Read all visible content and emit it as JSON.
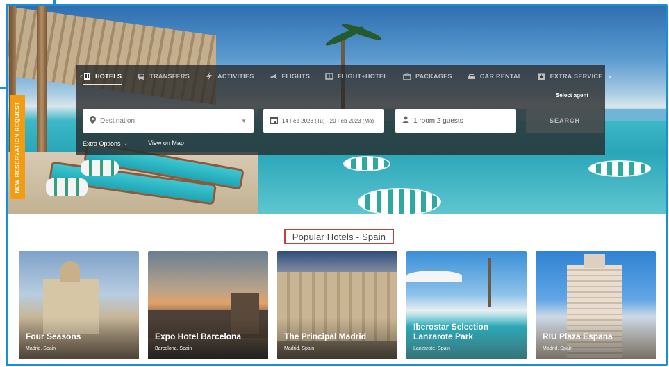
{
  "search_panel": {
    "tabs": [
      {
        "label": "HOTELS",
        "active": true,
        "icon": "building-icon"
      },
      {
        "label": "TRANSFERS",
        "active": false,
        "icon": "bus-icon"
      },
      {
        "label": "ACTIVITIES",
        "active": false,
        "icon": "bolt-icon"
      },
      {
        "label": "FLIGHTS",
        "active": false,
        "icon": "plane-icon"
      },
      {
        "label": "FLIGHT+HOTEL",
        "active": false,
        "icon": "ticket-icon"
      },
      {
        "label": "PACKAGES",
        "active": false,
        "icon": "suitcase-icon"
      },
      {
        "label": "CAR RENTAL",
        "active": false,
        "icon": "car-icon"
      },
      {
        "label": "EXTRA SERVICE",
        "active": false,
        "icon": "star-icon"
      }
    ],
    "select_agent": "Select agent",
    "destination_placeholder": "Destination",
    "dates": "14 Feb 2023 (Tu) - 20 Feb 2023 (Mo)",
    "guests": "1 room 2 guests",
    "search_label": "SEARCH",
    "extra_options": "Extra Options",
    "view_on_map": "View on Map"
  },
  "side_tab": "NEW RESERVATION REQUEST",
  "popular": {
    "title": "Popular Hotels - Spain",
    "hotels": [
      {
        "name": "Four Seasons",
        "location": "Madrid, Spain"
      },
      {
        "name": "Expo Hotel Barcelona",
        "location": "Barcelona, Spain"
      },
      {
        "name": "The Principal Madrid",
        "location": "Madrid, Spain"
      },
      {
        "name": "Iberostar Selection Lanzarote Park",
        "location": "Lanzarote, Spain"
      },
      {
        "name": "RIU Plaza Espana",
        "location": "Madrid, Spain"
      }
    ]
  },
  "colors": {
    "frame": "#1a8fd6",
    "side_tab": "#f39c12",
    "title_border": "#d23b3b"
  }
}
